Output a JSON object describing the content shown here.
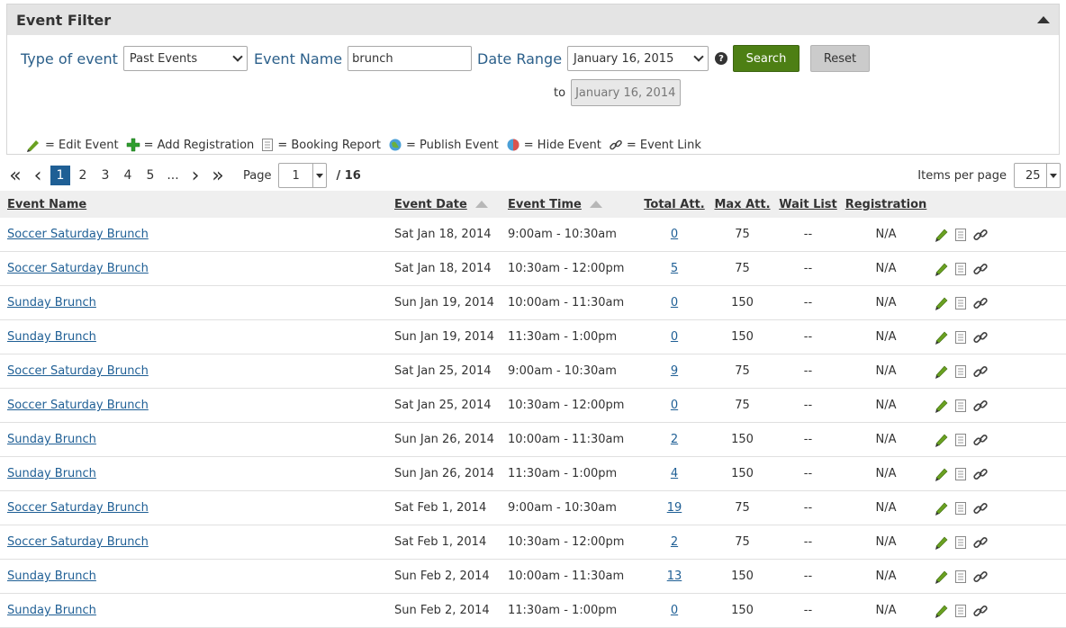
{
  "filter": {
    "title": "Event Filter",
    "type_label": "Type of event",
    "type_value": "Past Events",
    "name_label": "Event Name",
    "name_value": "brunch",
    "date_label": "Date Range",
    "date_from": "January 16, 2015",
    "help": "?",
    "to_label": "to",
    "date_to": "January 16, 2014",
    "search_label": "Search",
    "reset_label": "Reset"
  },
  "legend": [
    {
      "icon": "pencil-icon",
      "text": "= Edit Event"
    },
    {
      "icon": "plus-icon",
      "text": "= Add Registration"
    },
    {
      "icon": "report-icon",
      "text": "= Booking Report"
    },
    {
      "icon": "globe-icon",
      "text": "= Publish Event"
    },
    {
      "icon": "globe-hide-icon",
      "text": "= Hide Event"
    },
    {
      "icon": "link-icon",
      "text": "= Event Link"
    }
  ],
  "pager": {
    "first": "«",
    "prev": "‹",
    "next": "›",
    "last": "»",
    "pages": [
      "1",
      "2",
      "3",
      "4",
      "5",
      "..."
    ],
    "page_label": "Page",
    "page_value": "1",
    "total": "/ 16",
    "ipp_label": "Items per page",
    "ipp_value": "25"
  },
  "table": {
    "headers": [
      "Event Name",
      "Event Date",
      "Event Time",
      "Total Att.",
      "Max Att.",
      "Wait List",
      "Registration"
    ],
    "rows": [
      {
        "name": "Soccer Saturday Brunch",
        "date": "Sat Jan 18, 2014",
        "time": "9:00am - 10:30am",
        "total": "0",
        "max": "75",
        "wait": "--",
        "reg": "N/A"
      },
      {
        "name": "Soccer Saturday Brunch",
        "date": "Sat Jan 18, 2014",
        "time": "10:30am - 12:00pm",
        "total": "5",
        "max": "75",
        "wait": "--",
        "reg": "N/A"
      },
      {
        "name": "Sunday Brunch",
        "date": "Sun Jan 19, 2014",
        "time": "10:00am - 11:30am",
        "total": "0",
        "max": "150",
        "wait": "--",
        "reg": "N/A"
      },
      {
        "name": "Sunday Brunch",
        "date": "Sun Jan 19, 2014",
        "time": "11:30am - 1:00pm",
        "total": "0",
        "max": "150",
        "wait": "--",
        "reg": "N/A"
      },
      {
        "name": "Soccer Saturday Brunch",
        "date": "Sat Jan 25, 2014",
        "time": "9:00am - 10:30am",
        "total": "9",
        "max": "75",
        "wait": "--",
        "reg": "N/A"
      },
      {
        "name": "Soccer Saturday Brunch",
        "date": "Sat Jan 25, 2014",
        "time": "10:30am - 12:00pm",
        "total": "0",
        "max": "75",
        "wait": "--",
        "reg": "N/A"
      },
      {
        "name": "Sunday Brunch",
        "date": "Sun Jan 26, 2014",
        "time": "10:00am - 11:30am",
        "total": "2",
        "max": "150",
        "wait": "--",
        "reg": "N/A"
      },
      {
        "name": "Sunday Brunch",
        "date": "Sun Jan 26, 2014",
        "time": "11:30am - 1:00pm",
        "total": "4",
        "max": "150",
        "wait": "--",
        "reg": "N/A"
      },
      {
        "name": "Soccer Saturday Brunch",
        "date": "Sat Feb 1, 2014",
        "time": "9:00am - 10:30am",
        "total": "19",
        "max": "75",
        "wait": "--",
        "reg": "N/A"
      },
      {
        "name": "Soccer Saturday Brunch",
        "date": "Sat Feb 1, 2014",
        "time": "10:30am - 12:00pm",
        "total": "2",
        "max": "75",
        "wait": "--",
        "reg": "N/A"
      },
      {
        "name": "Sunday Brunch",
        "date": "Sun Feb 2, 2014",
        "time": "10:00am - 11:30am",
        "total": "13",
        "max": "150",
        "wait": "--",
        "reg": "N/A"
      },
      {
        "name": "Sunday Brunch",
        "date": "Sun Feb 2, 2014",
        "time": "11:30am - 1:00pm",
        "total": "0",
        "max": "150",
        "wait": "--",
        "reg": "N/A"
      }
    ]
  },
  "colors": {
    "link": "#1f5f95",
    "search": "#4d7f14",
    "active_page": "#1f5f95",
    "pencil": "#6aa121"
  }
}
